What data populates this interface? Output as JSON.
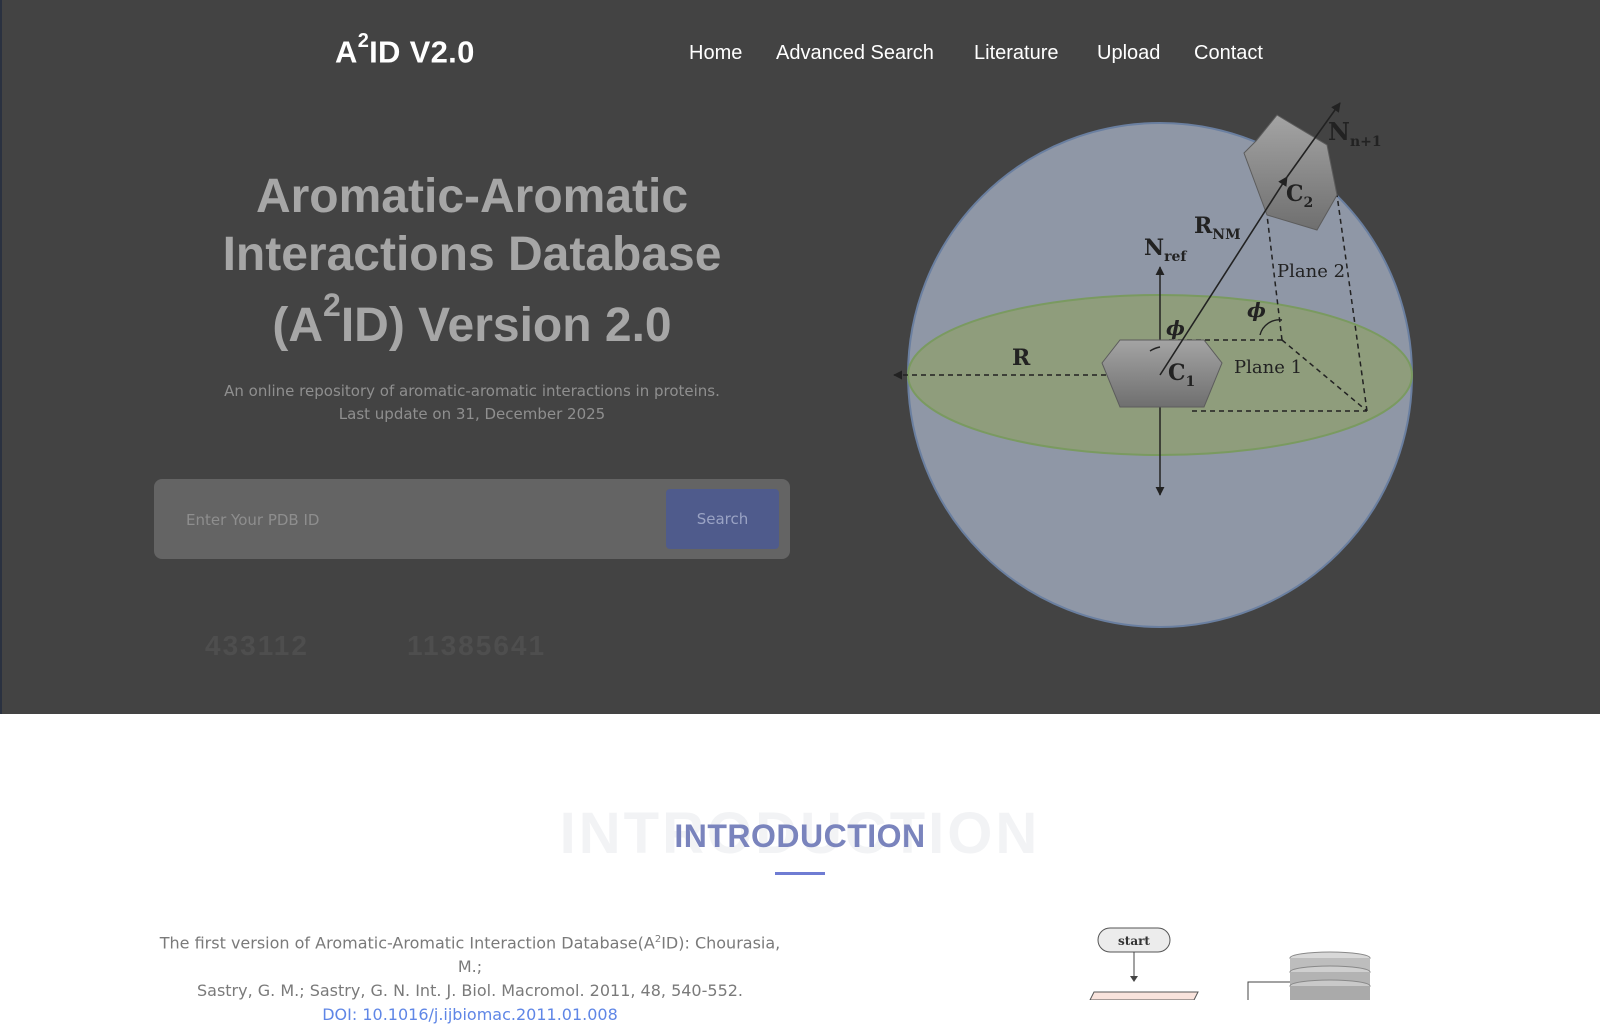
{
  "header": {
    "brand_prefix": "A",
    "brand_sup": "2",
    "brand_suffix": "ID V2.0",
    "nav": [
      "Home",
      "Advanced Search",
      "Literature",
      "Upload",
      "Contact"
    ]
  },
  "hero": {
    "title_line1": "Aromatic-Aromatic",
    "title_line2": "Interactions Database",
    "title_line3_prefix": "(A",
    "title_line3_sup": "2",
    "title_line3_suffix": "ID) Version 2.0",
    "subtitle_line1": "An online repository of aromatic-aromatic interactions in proteins.",
    "subtitle_line2": "Last update on 31, December 2025"
  },
  "search": {
    "placeholder": "Enter Your PDB ID",
    "button_label": "Search"
  },
  "stats": [
    {
      "value": "433112"
    },
    {
      "value": "11385641"
    }
  ],
  "diagram": {
    "labels": {
      "n_next": "N",
      "n_next_sub": "n+1",
      "c2": "C",
      "c2_sub": "2",
      "rnm": "R",
      "rnm_sub": "NM",
      "nref": "N",
      "nref_sub": "ref",
      "plane2": "Plane 2",
      "phi": "ϕ",
      "r": "R",
      "c1": "C",
      "c1_sub": "1",
      "plane1": "Plane 1"
    },
    "colors": {
      "sphere": "#8f97a6",
      "plane": "#8f9d7c",
      "ring": "#8a8a8a"
    }
  },
  "introduction": {
    "background_text": "INTRODUCTION",
    "title": "INTRODUCTION",
    "citation_prefix": "The first version of Aromatic-Aromatic Interaction Database(A",
    "citation_sup": "2",
    "citation_suffix": "ID): Chourasia, M.;",
    "citation_line2": "Sastry, G. M.; Sastry, G. N. Int. J. Biol. Macromol. 2011, 48, 540-552.",
    "doi_label": "DOI: 10.1016/j.ijbiomac.2011.01.008",
    "flow_start": "start"
  }
}
